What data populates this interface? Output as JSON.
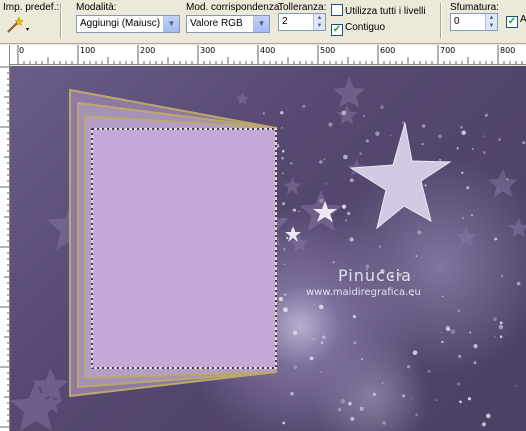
{
  "toolbar": {
    "presets_label": "Imp. predef.:",
    "mode_label": "Modalità:",
    "mode_value": "Aggiungi (Maiusc)",
    "match_label": "Mod. corrispondenza:",
    "match_value": "Valore RGB",
    "tolerance_label": "Tolleranza:",
    "tolerance_value": "2",
    "use_all_layers_label": "Utilizza tutti i livelli",
    "use_all_layers_checked": false,
    "contiguous_label": "Contiguo",
    "contiguous_checked": true,
    "feather_label": "Sfumatura:",
    "feather_value": "0",
    "antialias_partial": "A"
  },
  "ruler": {
    "ticks": [
      "0",
      "100",
      "200",
      "300",
      "400",
      "500",
      "600",
      "700",
      "800"
    ]
  },
  "canvas": {
    "watermark_name": "Pinuccia",
    "watermark_url": "www.maidiregrafica.eu"
  },
  "colors": {
    "frame_fill": "#c4a8d8",
    "background": "#564870"
  }
}
